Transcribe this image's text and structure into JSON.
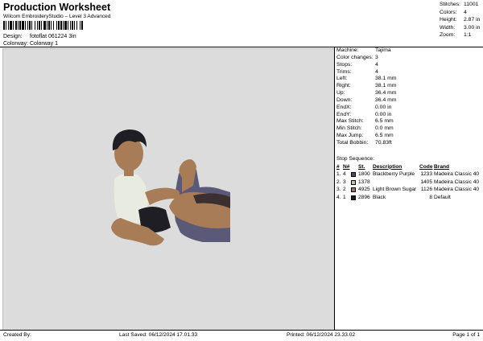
{
  "header": {
    "title": "Production Worksheet",
    "subtitle": "Wilcom EmbroideryStudio – Level 3 Advanced"
  },
  "design": {
    "label": "Design:",
    "value": "fotoflat 061224 3in"
  },
  "colorway": {
    "label": "Colorway:",
    "value": "Colorway 1"
  },
  "summary": [
    {
      "key": "Stitches:",
      "value": "11001"
    },
    {
      "key": "Colors:",
      "value": "4"
    },
    {
      "key": "Height:",
      "value": "2.87 in"
    },
    {
      "key": "Width:",
      "value": "3.00 in"
    },
    {
      "key": "Zoom:",
      "value": "1:1"
    }
  ],
  "machine_info": [
    {
      "key": "Machine:",
      "value": "Tajima"
    },
    {
      "key": "Color changes:",
      "value": "3"
    },
    {
      "key": "Stops:",
      "value": "4"
    },
    {
      "key": "Trims:",
      "value": "4"
    },
    {
      "key": "Left:",
      "value": "38.1 mm"
    },
    {
      "key": "Right:",
      "value": "38.1 mm"
    },
    {
      "key": "Up:",
      "value": "36.4 mm"
    },
    {
      "key": "Down:",
      "value": "36.4 mm"
    },
    {
      "key": "EndX:",
      "value": "0.00 in"
    },
    {
      "key": "EndY:",
      "value": "0.00 in"
    },
    {
      "key": "Max Stitch:",
      "value": "6.5 mm"
    },
    {
      "key": "Min Stitch:",
      "value": "0.0 mm"
    },
    {
      "key": "Max Jump:",
      "value": "6.5 mm"
    },
    {
      "key": "Total Bobbin:",
      "value": "70.83ft"
    }
  ],
  "stop_sequence": {
    "label": "Stop Sequence:",
    "columns": [
      "#",
      "N#",
      "St.",
      "Description",
      "Code",
      "Brand"
    ],
    "rows": [
      {
        "num": "1.",
        "n": "4",
        "color": "#4a4a6a",
        "st": "1800",
        "desc": "Blackberry Purple",
        "code": "1233",
        "brand": "Madeira Classic 40"
      },
      {
        "num": "2.",
        "n": "3",
        "color": "#c8c0a8",
        "st": "1378",
        "desc": "",
        "code": "1405",
        "brand": "Madeira Classic 40"
      },
      {
        "num": "3.",
        "n": "2",
        "color": "#a07850",
        "st": "4925",
        "desc": "Light Brown Sugar",
        "code": "1126",
        "brand": "Madeira Classic 40"
      },
      {
        "num": "4.",
        "n": "1",
        "color": "#1a1a1a",
        "st": "2896",
        "desc": "Black",
        "code": "8",
        "brand": "Default"
      }
    ]
  },
  "footer": {
    "created_by": "Created By:",
    "last_saved": "Last Saved: 06/12/2024 17.01.33",
    "printed": "Printed: 06/12/2024 23.33.02",
    "page": "Page 1 of 1"
  },
  "colors": {
    "canvas_bg": "#dcdcdc",
    "skin": "#a87c56",
    "hair": "#1e1e24",
    "shirt": "#e8ece0",
    "pants": "#5a5a78"
  }
}
